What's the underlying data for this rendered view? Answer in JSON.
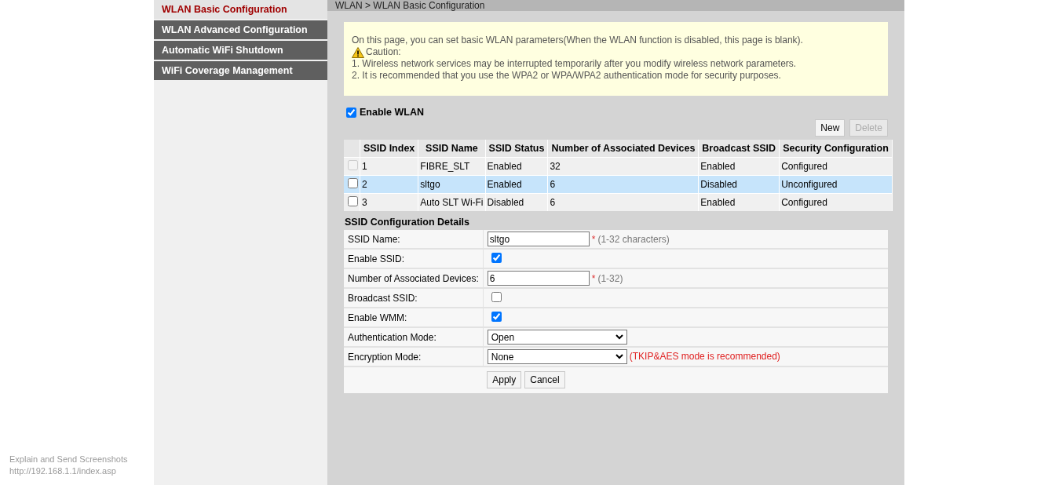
{
  "sidebar": {
    "items": [
      {
        "label": "WLAN Basic Configuration",
        "selected": true
      },
      {
        "label": "WLAN Advanced Configuration",
        "selected": false
      },
      {
        "label": "Automatic WiFi Shutdown",
        "selected": false
      },
      {
        "label": "WiFi Coverage Management",
        "selected": false
      }
    ]
  },
  "breadcrumb": "WLAN > WLAN Basic Configuration",
  "notice": {
    "intro": "On this page, you can set basic WLAN parameters(When the WLAN function is disabled, this page is blank).",
    "caution_label": "Caution:",
    "lines": [
      "1. Wireless network services may be interrupted temporarily after you modify wireless network parameters.",
      "2. It is recommended that you use the WPA2 or WPA/WPA2 authentication mode for security purposes."
    ]
  },
  "enable_wlan": {
    "label": "Enable WLAN",
    "checked": true
  },
  "buttons": [
    {
      "label": "New",
      "disabled": false
    },
    {
      "label": "Delete",
      "disabled": true
    }
  ],
  "table": {
    "columns": [
      "SSID Index",
      "SSID Name",
      "SSID Status",
      "Number of Associated Devices",
      "Broadcast SSID",
      "Security Configuration"
    ],
    "rows": [
      {
        "selected": false,
        "checked": false,
        "disabled": true,
        "cells": [
          "1",
          "FIBRE_SLT",
          "Enabled",
          "32",
          "Enabled",
          "Configured"
        ]
      },
      {
        "selected": true,
        "checked": false,
        "disabled": false,
        "cells": [
          "2",
          "sltgo",
          "Enabled",
          "6",
          "Disabled",
          "Unconfigured"
        ]
      },
      {
        "selected": false,
        "checked": false,
        "disabled": false,
        "cells": [
          "3",
          "Auto SLT Wi-Fi",
          "Disabled",
          "6",
          "Enabled",
          "Configured"
        ]
      }
    ]
  },
  "details": {
    "title": "SSID Configuration Details",
    "fields": [
      {
        "kind": "text",
        "label": "SSID Name:",
        "value": "sltgo",
        "required": "*",
        "hint": "(1-32 characters)"
      },
      {
        "kind": "checkbox",
        "label": "Enable SSID:",
        "checked": true
      },
      {
        "kind": "text",
        "label": "Number of Associated Devices:",
        "value": "6",
        "required": "*",
        "hint": "(1-32)"
      },
      {
        "kind": "checkbox",
        "label": "Broadcast SSID:",
        "checked": false
      },
      {
        "kind": "checkbox",
        "label": "Enable WMM:",
        "checked": true
      },
      {
        "kind": "select",
        "label": "Authentication Mode:",
        "value": "Open"
      },
      {
        "kind": "select",
        "label": "Encryption Mode:",
        "value": "None",
        "warning": "(TKIP&AES mode is recommended)"
      }
    ],
    "actions": [
      "Apply",
      "Cancel"
    ]
  },
  "overlay": {
    "title": "Explain and Send Screenshots",
    "url": "http://192.168.1.1/index.asp"
  }
}
